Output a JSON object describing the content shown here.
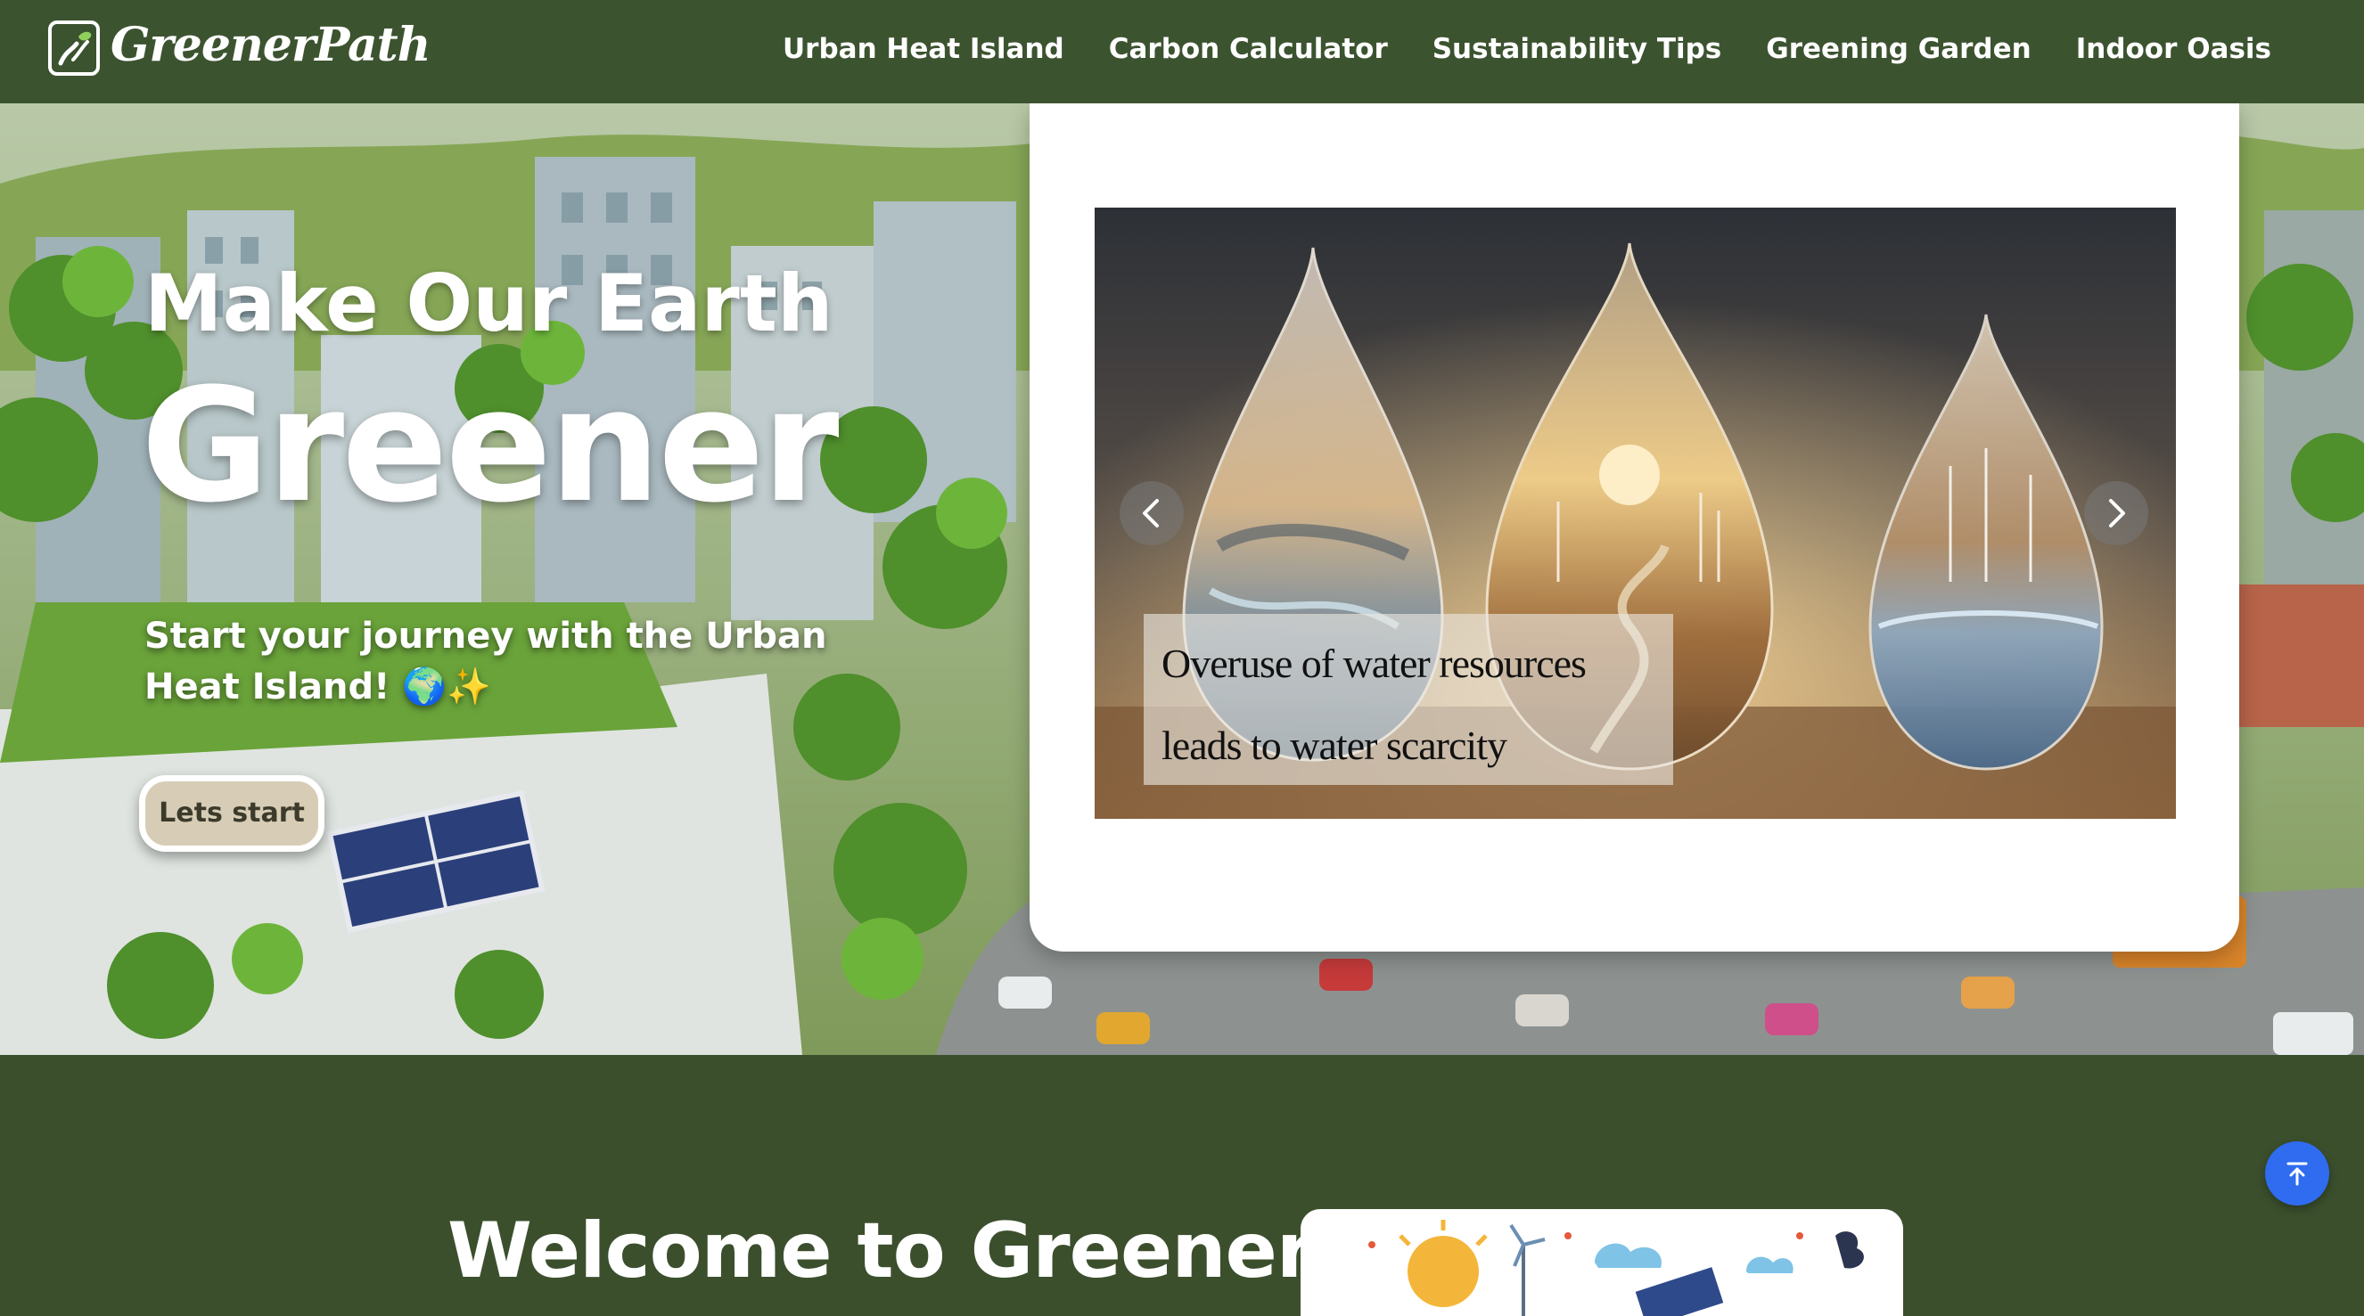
{
  "brand": {
    "name": "GreenerPath"
  },
  "nav": {
    "items": [
      {
        "label": "Urban Heat Island"
      },
      {
        "label": "Carbon Calculator"
      },
      {
        "label": "Sustainability Tips"
      },
      {
        "label": "Greening Garden"
      },
      {
        "label": "Indoor Oasis"
      }
    ]
  },
  "hero": {
    "title_line": "Make Our Earth",
    "title_big": "Greener",
    "subtitle": "Start your journey with the Urban Heat Island! 🌍✨",
    "cta_label": "Lets start"
  },
  "carousel": {
    "caption": "Overuse of water resources leads to water scarcity",
    "prev_icon": "chevron-left-icon",
    "next_icon": "chevron-right-icon"
  },
  "welcome": {
    "title": "Welcome to Greener"
  },
  "scroll_top": {
    "icon": "arrow-up-to-top-icon",
    "color": "#2f6cf0"
  },
  "colors": {
    "nav_bg": "#3c5330",
    "section_bg": "#3b4f2d",
    "cta_bg": "#d7cdb6"
  }
}
